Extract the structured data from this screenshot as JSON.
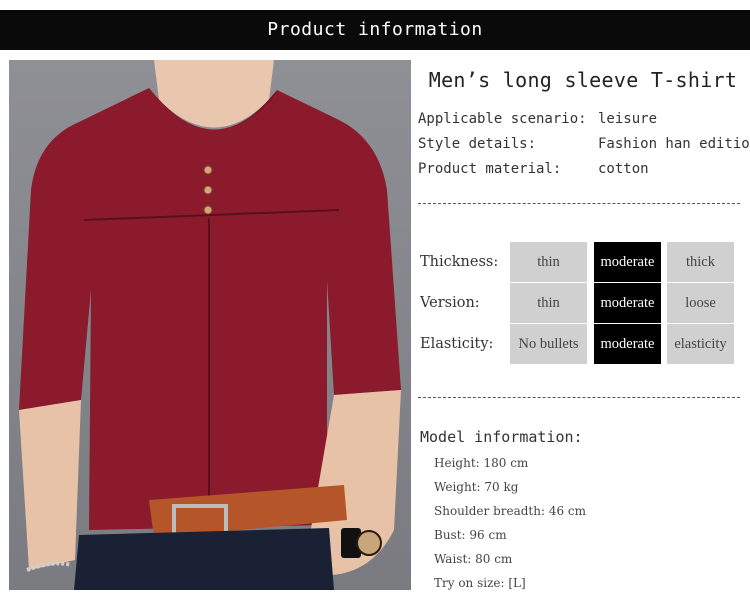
{
  "banner": {
    "title": "Product information"
  },
  "product": {
    "name": "Men’s long sleeve T-shirt",
    "specs": [
      {
        "key": "Applicable scenario:",
        "value": "leisure"
      },
      {
        "key": "Style details:",
        "value": "Fashion han edition"
      },
      {
        "key": "Product material:",
        "value": "cotton"
      }
    ]
  },
  "scales": [
    {
      "label": "Thickness:",
      "options": [
        "thin",
        "moderate",
        "thick"
      ],
      "selected": 1
    },
    {
      "label": "Version:",
      "options": [
        "thin",
        "moderate",
        "loose"
      ],
      "selected": 1
    },
    {
      "label": "Elasticity:",
      "options": [
        "No bullets",
        "moderate",
        "elasticity"
      ],
      "selected": 1
    }
  ],
  "model": {
    "heading": "Model information:",
    "items": [
      "Height: 180 cm",
      "Weight: 70 kg",
      "Shoulder breadth: 46 cm",
      "Bust: 96 cm",
      "Waist: 80 cm",
      "Try on size: [L]"
    ]
  },
  "colors": {
    "banner_bg": "#0a0a0a",
    "shirt": "#8a1a2c",
    "selected_cell": "#000000",
    "unselected_cell": "#d0d0d0"
  }
}
